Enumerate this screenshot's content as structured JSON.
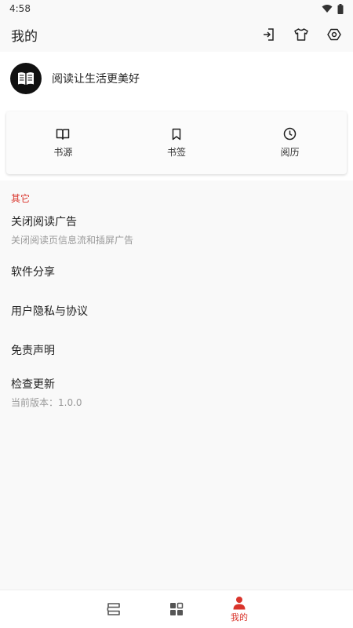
{
  "statusbar": {
    "time": "4:58"
  },
  "appbar": {
    "title": "我的"
  },
  "profile": {
    "slogan": "阅读让生活更美好"
  },
  "quick": [
    {
      "label": "书源",
      "icon": "book-open-icon"
    },
    {
      "label": "书签",
      "icon": "bookmark-icon"
    },
    {
      "label": "阅历",
      "icon": "clock-icon"
    }
  ],
  "section": {
    "title": "其它"
  },
  "menu": [
    {
      "title": "关闭阅读广告",
      "subtitle": "关闭阅读页信息流和插屏广告"
    },
    {
      "title": "软件分享"
    },
    {
      "title": "用户隐私与协议"
    },
    {
      "title": "免责声明"
    },
    {
      "title": "检查更新",
      "subtitle": "当前版本：1.0.0"
    }
  ],
  "bottomnav": {
    "mine_label": "我的"
  },
  "colors": {
    "accent": "#d9342b",
    "background": "#f9f9f9"
  }
}
